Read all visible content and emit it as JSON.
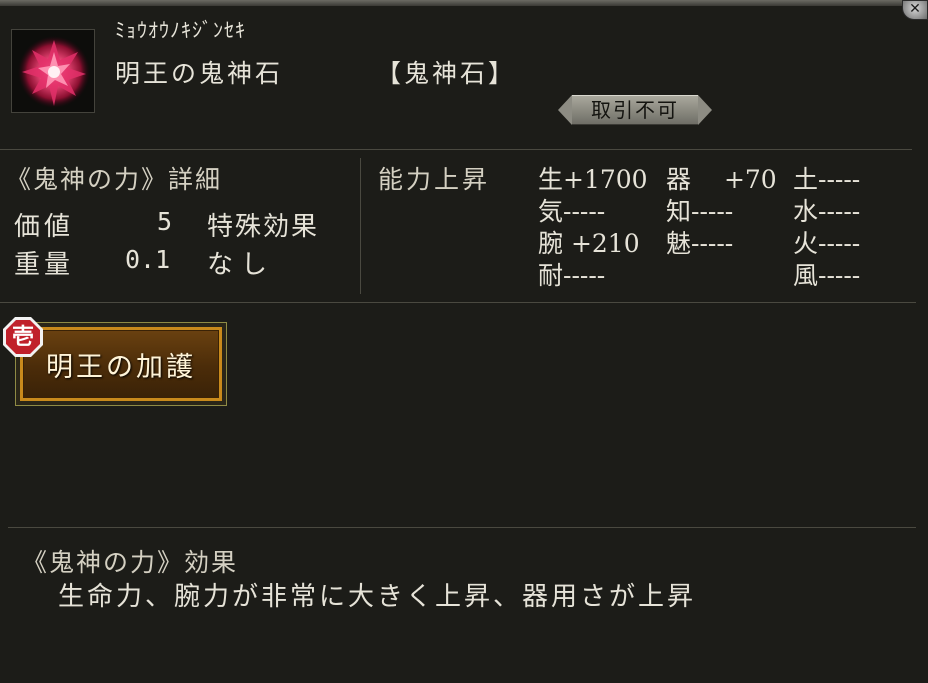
{
  "item": {
    "reading": "ﾐｮｳｵｳﾉｷｼﾞﾝｾｷ",
    "name": "明王の鬼神石",
    "type": "【鬼神石】",
    "trade_status": "取引不可",
    "icon": "red-crystal-icon"
  },
  "details": {
    "section_title": "《鬼神の力》詳細",
    "value_label": "価値",
    "value": "5",
    "weight_label": "重量",
    "weight": "0.1",
    "special_label": "特殊効果",
    "special_value": "なし"
  },
  "stats": {
    "section_title": "能力上昇",
    "col1": [
      "生+1700",
      "気-----",
      "腕 +210",
      "耐-----"
    ],
    "col2": [
      "器 　+70",
      "知-----",
      "魅-----"
    ],
    "col3": [
      "土-----",
      "水-----",
      "火-----",
      "風-----"
    ]
  },
  "effect_button": {
    "rank": "壱",
    "label": "明王の加護"
  },
  "effect": {
    "title": "《鬼神の力》効果",
    "description": "生命力、腕力が非常に大きく上昇、器用さが上昇"
  },
  "colors": {
    "background": "#1c1c18",
    "text": "#e6e3d8",
    "button_border": "#c98a1c",
    "rank_badge": "#c0202a"
  }
}
